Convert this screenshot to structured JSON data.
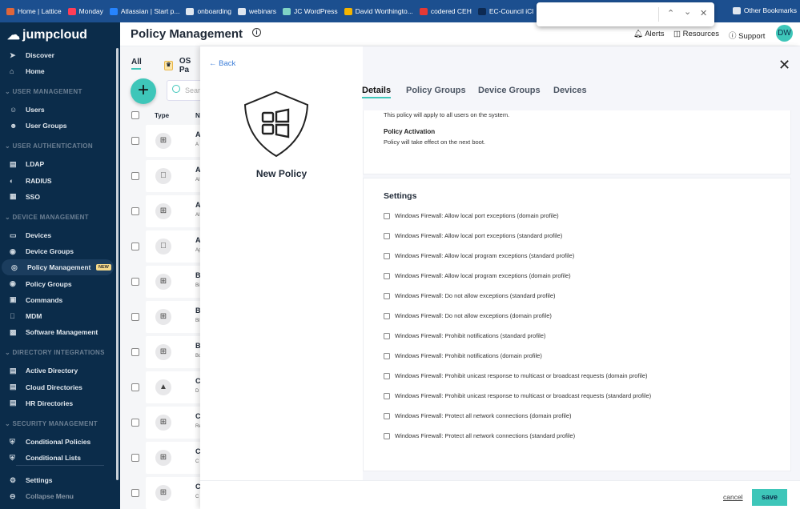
{
  "bookmarks": [
    {
      "label": "Home | Lattice",
      "color": "#e0663b"
    },
    {
      "label": "Monday",
      "color": "#ff3d57"
    },
    {
      "label": "Atlassian | Start p...",
      "color": "#2684ff"
    },
    {
      "label": "onboarding",
      "color": "#dfe6ef"
    },
    {
      "label": "webinars",
      "color": "#dfe6ef"
    },
    {
      "label": "JC WordPress",
      "color": "#7fd3c5"
    },
    {
      "label": "David Worthingto...",
      "color": "#f4b400"
    },
    {
      "label": "codered CEH",
      "color": "#e53935"
    },
    {
      "label": "EC-Council iCl",
      "color": "#0d2a52"
    }
  ],
  "other_bookmarks": "Other Bookmarks",
  "find_bar": {
    "value": ""
  },
  "sidebar": {
    "brand": "jumpcloud",
    "top": [
      {
        "label": "Discover",
        "icon": "rocket-icon"
      },
      {
        "label": "Home",
        "icon": "home-icon"
      }
    ],
    "sections": [
      {
        "title": "USER MANAGEMENT",
        "items": [
          {
            "label": "Users"
          },
          {
            "label": "User Groups"
          }
        ]
      },
      {
        "title": "USER AUTHENTICATION",
        "items": [
          {
            "label": "LDAP"
          },
          {
            "label": "RADIUS"
          },
          {
            "label": "SSO"
          }
        ]
      },
      {
        "title": "DEVICE MANAGEMENT",
        "items": [
          {
            "label": "Devices"
          },
          {
            "label": "Device Groups"
          },
          {
            "label": "Policy Management",
            "badge": "NEW",
            "active": true
          },
          {
            "label": "Policy Groups"
          },
          {
            "label": "Commands"
          },
          {
            "label": "MDM"
          },
          {
            "label": "Software Management"
          }
        ]
      },
      {
        "title": "DIRECTORY INTEGRATIONS",
        "items": [
          {
            "label": "Active Directory"
          },
          {
            "label": "Cloud Directories"
          },
          {
            "label": "HR Directories"
          }
        ]
      },
      {
        "title": "SECURITY MANAGEMENT",
        "items": [
          {
            "label": "Conditional Policies"
          },
          {
            "label": "Conditional Lists"
          }
        ]
      }
    ],
    "bottom": [
      {
        "label": "Settings"
      },
      {
        "label": "Collapse Menu"
      }
    ]
  },
  "header": {
    "title": "Policy Management",
    "alerts": "Alerts",
    "resources": "Resources",
    "support": "Support",
    "avatar": "DW"
  },
  "list": {
    "tabs": [
      "All",
      "OS Pa"
    ],
    "search_placeholder": "Sear",
    "col_type": "Type",
    "col_name": "N",
    "rows": [
      {
        "os": "windows",
        "name": "A",
        "sub": "A"
      },
      {
        "os": "apple",
        "name": "A",
        "sub": "Al"
      },
      {
        "os": "windows",
        "name": "A",
        "sub": "Al"
      },
      {
        "os": "apple",
        "name": "A",
        "sub": "Ap"
      },
      {
        "os": "windows",
        "name": "B",
        "sub": "Bi"
      },
      {
        "os": "windows",
        "name": "B",
        "sub": "Bl"
      },
      {
        "os": "windows",
        "name": "B",
        "sub": "Bo"
      },
      {
        "os": "linux",
        "name": "C",
        "sub": "D"
      },
      {
        "os": "windows",
        "name": "C",
        "sub": "Re"
      },
      {
        "os": "windows",
        "name": "C",
        "sub": "C"
      },
      {
        "os": "windows",
        "name": "C",
        "sub": "C"
      }
    ]
  },
  "panel": {
    "back": "Back",
    "policy_name": "New Policy",
    "tabs": [
      "Details",
      "Policy Groups",
      "Device Groups",
      "Devices"
    ],
    "active_tab": "Details",
    "details": {
      "apply_text": "This policy will apply to all users on the system.",
      "activation_title": "Policy Activation",
      "activation_text": "Policy will take effect on the next boot."
    },
    "settings_title": "Settings",
    "settings": [
      {
        "label": "Windows Firewall: Allow local port exceptions (domain profile)",
        "checked": false
      },
      {
        "label": "Windows Firewall: Allow local port exceptions (standard profile)",
        "checked": false
      },
      {
        "label": "Windows Firewall: Allow local program exceptions (standard profile)",
        "checked": false
      },
      {
        "label": "Windows Firewall: Allow local program exceptions (domain profile)",
        "checked": false
      },
      {
        "label": "Windows Firewall: Do not allow exceptions (standard profile)",
        "checked": false
      },
      {
        "label": "Windows Firewall: Do not allow exceptions (domain profile)",
        "checked": false
      },
      {
        "label": "Windows Firewall: Prohibit notifications (standard profile)",
        "checked": false
      },
      {
        "label": "Windows Firewall: Prohibit notifications (domain profile)",
        "checked": false
      },
      {
        "label": "Windows Firewall: Prohibit unicast response to multicast or broadcast requests (domain profile)",
        "checked": false
      },
      {
        "label": "Windows Firewall: Prohibit unicast response to multicast or broadcast requests (standard profile)",
        "checked": false
      },
      {
        "label": "Windows Firewall: Protect all network connections (domain profile)",
        "checked": false
      },
      {
        "label": "Windows Firewall: Protect all network connections (standard profile)",
        "checked": false
      }
    ],
    "cancel": "cancel",
    "save": "save"
  },
  "colors": {
    "accent": "#3ec6b9",
    "sidebar": "#0b2c4a",
    "link": "#3b7dd8",
    "bookmark_bar": "#1c4f8f"
  }
}
